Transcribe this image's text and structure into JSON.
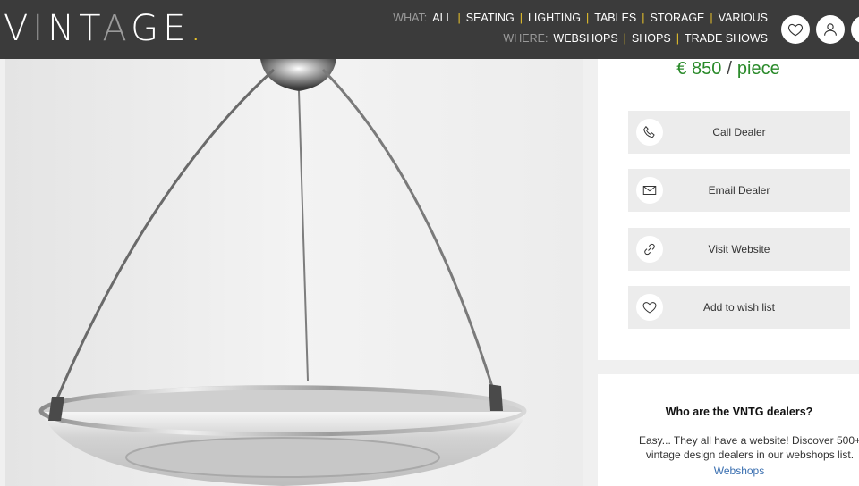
{
  "header": {
    "logo": {
      "part1": "V",
      "part2": "I",
      "part3": "NT",
      "part4": "A",
      "part5": "GE",
      "dot": "."
    },
    "what_label": "WHAT:",
    "what_links": [
      "ALL",
      "SEATING",
      "LIGHTING",
      "TABLES",
      "STORAGE",
      "VARIOUS"
    ],
    "where_label": "WHERE:",
    "where_links": [
      "WEBSHOPS",
      "SHOPS",
      "TRADE SHOWS"
    ],
    "icons": [
      "heart-icon",
      "user-icon",
      "more-icon"
    ]
  },
  "price": {
    "amount": "€ 850",
    "slash": "/",
    "unit": "piece"
  },
  "actions": [
    {
      "label": "Call Dealer",
      "icon": "phone-icon"
    },
    {
      "label": "Email Dealer",
      "icon": "envelope-icon"
    },
    {
      "label": "Visit Website",
      "icon": "link-icon"
    },
    {
      "label": "Add to wish list",
      "icon": "heart-icon"
    }
  ],
  "info": {
    "title": "Who are the VNTG dealers?",
    "text": "Easy... They all have a website! Discover 500+ vintage design dealers in our webshops list.",
    "link": "Webshops"
  },
  "colors": {
    "header_bg": "#3b3b3b",
    "accent_yellow": "#e8c22a",
    "price_green": "#2a8a2a",
    "link_blue": "#3a6fb0"
  }
}
